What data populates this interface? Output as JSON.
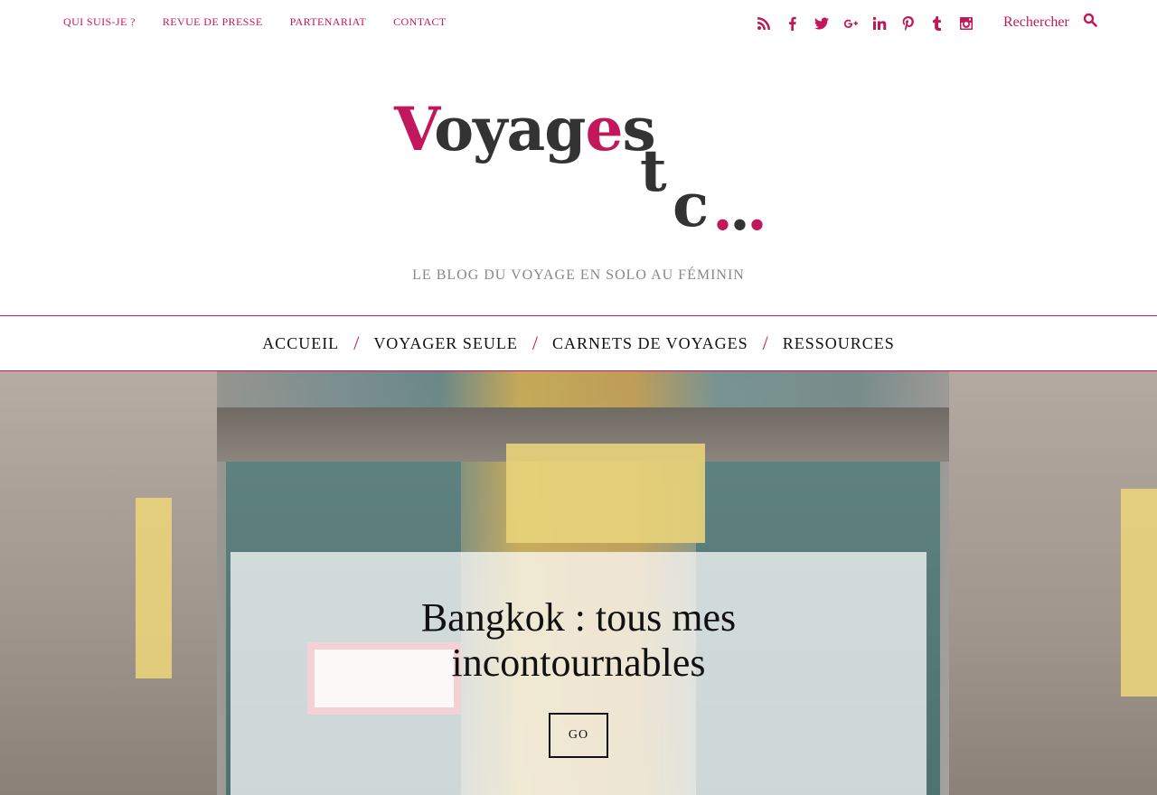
{
  "topnav": {
    "items": [
      {
        "label": "QUI SUIS-JE ?"
      },
      {
        "label": "REVUE DE PRESSE"
      },
      {
        "label": "PARTENARIAT"
      },
      {
        "label": "CONTACT"
      }
    ]
  },
  "social": {
    "icons": [
      "rss-icon",
      "facebook-icon",
      "twitter-icon",
      "google-plus-icon",
      "linkedin-icon",
      "pinterest-icon",
      "tumblr-icon",
      "instagram-icon"
    ],
    "color": "#c2185b"
  },
  "search": {
    "placeholder": "Rechercher"
  },
  "logo": {
    "first_letter": "V",
    "middle": "oyag",
    "accent_letter": "e",
    "end": "s",
    "t": "t",
    "c": "c",
    "dots": "...",
    "accent_color": "#c2185b"
  },
  "tagline": "LE BLOG DU VOYAGE EN SOLO AU FÉMININ",
  "mainnav": {
    "items": [
      {
        "label": "ACCUEIL"
      },
      {
        "label": "VOYAGER SEULE"
      },
      {
        "label": "CARNETS DE VOYAGES"
      },
      {
        "label": "RESSOURCES"
      }
    ],
    "separator": "/"
  },
  "hero": {
    "title": "Bangkok : tous mes incontournables",
    "button_label": "GO"
  }
}
